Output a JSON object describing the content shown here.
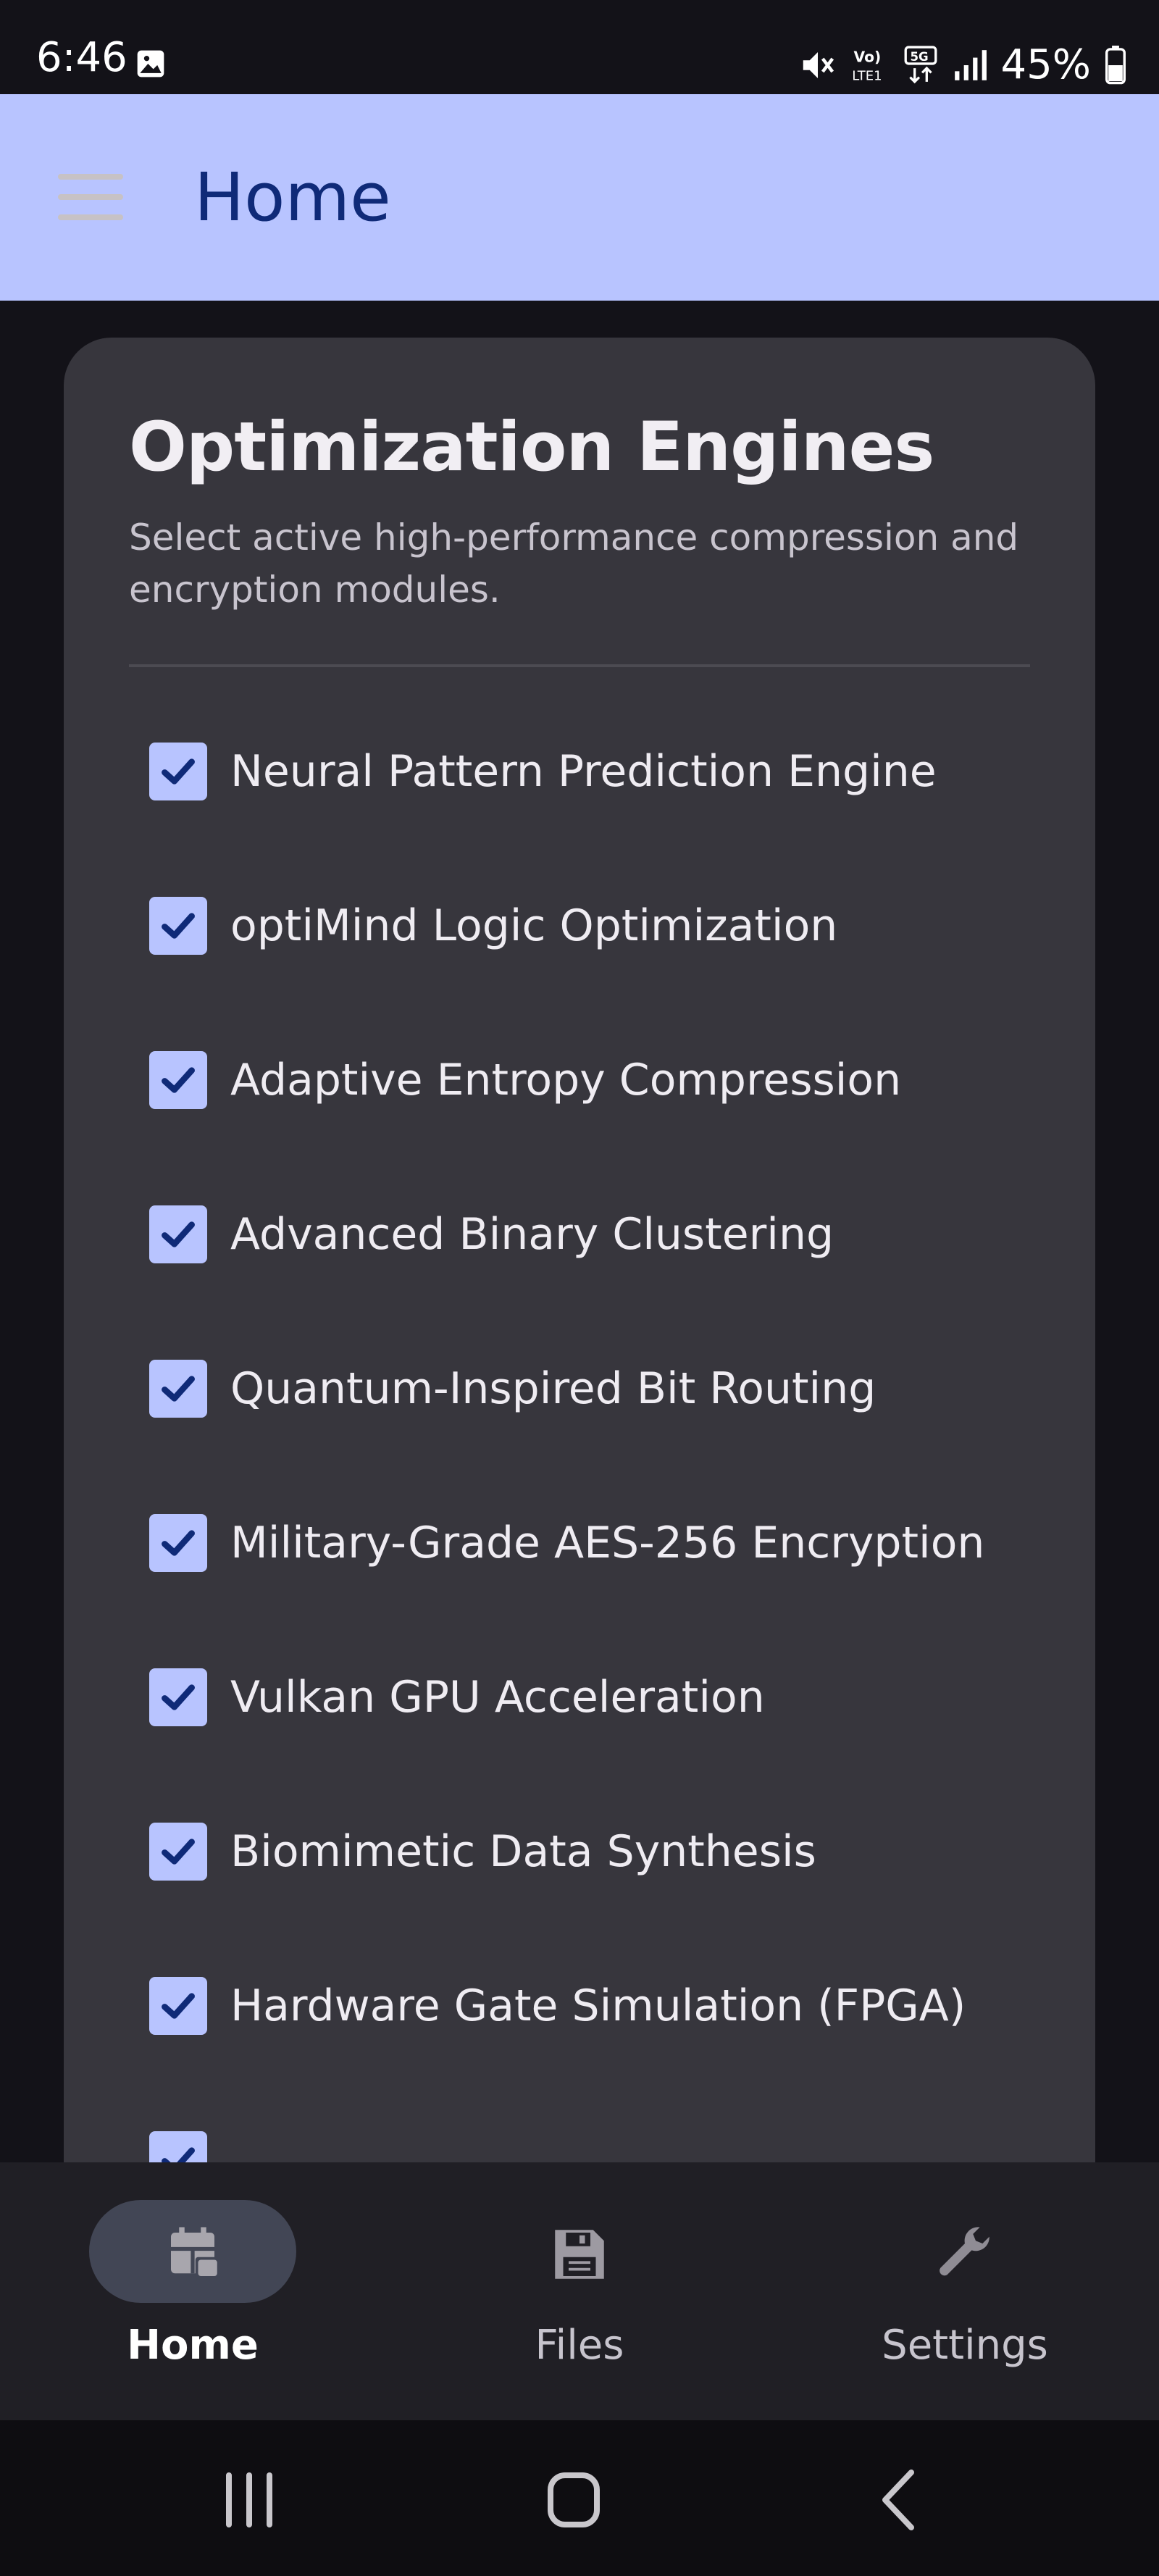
{
  "status_bar": {
    "time": "6:46",
    "battery": "45%",
    "icons": [
      "gallery-icon",
      "mute-icon",
      "volte-icon",
      "5g-icon",
      "signal-icon",
      "battery-icon"
    ]
  },
  "app_bar": {
    "title": "Home",
    "menu_icon": "hamburger-menu-icon",
    "background": "#b8c4ff"
  },
  "card": {
    "title": "Optimization Engines",
    "subtitle": "Select active high-performance compression and encryption modules.",
    "options": [
      {
        "label": "Neural Pattern Prediction Engine",
        "checked": true
      },
      {
        "label": "optiMind Logic Optimization",
        "checked": true
      },
      {
        "label": "Adaptive Entropy Compression",
        "checked": true
      },
      {
        "label": "Advanced Binary Clustering",
        "checked": true
      },
      {
        "label": "Quantum-Inspired Bit Routing",
        "checked": true
      },
      {
        "label": "Military-Grade AES-256 Encryption",
        "checked": true
      },
      {
        "label": "Vulkan GPU Acceleration",
        "checked": true
      },
      {
        "label": "Biomimetic Data Synthesis",
        "checked": true
      },
      {
        "label": "Hardware Gate Simulation (FPGA)",
        "checked": true
      }
    ]
  },
  "bottom_nav": {
    "items": [
      {
        "label": "Home",
        "icon": "home-apps-icon",
        "active": true
      },
      {
        "label": "Files",
        "icon": "save-floppy-icon",
        "active": false
      },
      {
        "label": "Settings",
        "icon": "wrench-icon",
        "active": false
      }
    ]
  },
  "system_nav": {
    "buttons": [
      "recents-icon",
      "home-circle-icon",
      "back-chevron-icon"
    ]
  },
  "colors": {
    "accent": "#b8c4ff",
    "card": "#37363d",
    "background": "#131218"
  }
}
